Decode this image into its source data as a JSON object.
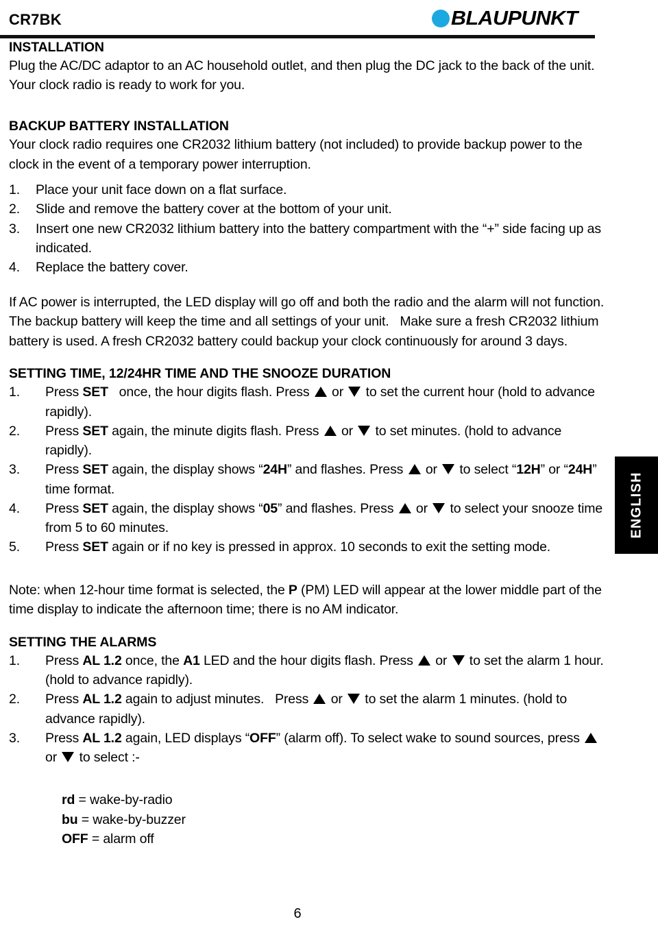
{
  "header": {
    "model_code": "CR7BK",
    "brand": "BLAUPUNKT",
    "brand_dot_color": "#1CA9E0"
  },
  "language_tab": {
    "label": "ENGLISH"
  },
  "page_number": "6",
  "sections": {
    "installation": {
      "title": "INSTALLATION",
      "body": "Plug the AC/DC adaptor to an AC household outlet, and then plug the DC jack to the back of the unit. Your clock radio is ready to work for you."
    },
    "backup_battery": {
      "title": "BACKUP BATTERY INSTALLATION",
      "intro": "Your clock radio requires one CR2032 lithium battery (not included) to provide backup power to the clock in the event of a temporary power interruption.",
      "steps": [
        {
          "num": "1.",
          "text": "Place your unit face down on a flat surface."
        },
        {
          "num": "2.",
          "text": "Slide and remove the battery cover at the bottom of your unit."
        },
        {
          "num": "3.",
          "text": "Insert one new CR2032 lithium battery into the battery compartment with the “+” side facing up as indicated."
        },
        {
          "num": "4.",
          "text": "Replace the battery cover."
        }
      ],
      "outro": "If AC power is interrupted, the LED display will go off and both the radio and the alarm will not function. The backup battery will keep the time and all settings of your unit.   Make sure a fresh CR2032 lithium battery is used. A fresh CR2032 battery could backup your clock continuously for around 3 days."
    },
    "setting_time": {
      "title": "SETTING TIME, 12/24HR TIME AND THE SNOOZE DURATION",
      "steps": [
        {
          "num": "1.",
          "parts": [
            {
              "t": "Press "
            },
            {
              "t": "SET",
              "b": true
            },
            {
              "t": "   once, the hour digits flash. Press "
            },
            {
              "icon": "triangle-up-icon"
            },
            {
              "t": " or "
            },
            {
              "icon": "triangle-down-icon"
            },
            {
              "t": " to set the current hour (hold to advance rapidly)."
            }
          ]
        },
        {
          "num": "2.",
          "parts": [
            {
              "t": "Press "
            },
            {
              "t": "SET",
              "b": true
            },
            {
              "t": " again, the minute digits flash. Press "
            },
            {
              "icon": "triangle-up-icon"
            },
            {
              "t": " or "
            },
            {
              "icon": "triangle-down-icon"
            },
            {
              "t": " to set minutes. (hold to advance rapidly)."
            }
          ]
        },
        {
          "num": "3.",
          "parts": [
            {
              "t": "Press "
            },
            {
              "t": "SET",
              "b": true
            },
            {
              "t": " again, the display shows “"
            },
            {
              "t": "24H",
              "b": true
            },
            {
              "t": "” and flashes. Press "
            },
            {
              "icon": "triangle-up-icon"
            },
            {
              "t": " or "
            },
            {
              "icon": "triangle-down-icon"
            },
            {
              "t": " to select “"
            },
            {
              "t": "12H",
              "b": true
            },
            {
              "t": "” or “"
            },
            {
              "t": "24H",
              "b": true
            },
            {
              "t": "” time format."
            }
          ]
        },
        {
          "num": "4.",
          "parts": [
            {
              "t": "Press "
            },
            {
              "t": "SET",
              "b": true
            },
            {
              "t": " again, the display shows “"
            },
            {
              "t": "05",
              "b": true
            },
            {
              "t": "” and flashes. Press "
            },
            {
              "icon": "triangle-up-icon"
            },
            {
              "t": " or "
            },
            {
              "icon": "triangle-down-icon"
            },
            {
              "t": " to select your snooze time from 5 to 60 minutes."
            }
          ]
        },
        {
          "num": "5.",
          "parts": [
            {
              "t": "Press "
            },
            {
              "t": "SET",
              "b": true
            },
            {
              "t": " again or if no key is pressed in approx. 10 seconds to exit the setting mode."
            }
          ]
        }
      ]
    },
    "note": {
      "parts": [
        {
          "t": "Note: when 12-hour time format is selected, the "
        },
        {
          "t": "P",
          "b": true
        },
        {
          "t": " (PM) LED will appear at the lower middle part of the time display to indicate the afternoon time; there is no AM indicator."
        }
      ]
    },
    "setting_alarms": {
      "title": "SETTING THE ALARMS",
      "steps": [
        {
          "num": "1.",
          "parts": [
            {
              "t": "Press "
            },
            {
              "t": "AL 1.2",
              "b": true
            },
            {
              "t": " once, the "
            },
            {
              "t": "A1",
              "b": true
            },
            {
              "t": " LED and the hour digits flash. Press "
            },
            {
              "icon": "triangle-up-icon"
            },
            {
              "t": " or "
            },
            {
              "icon": "triangle-down-icon"
            },
            {
              "t": " to set the alarm 1 hour. (hold to advance rapidly)."
            }
          ]
        },
        {
          "num": "2.",
          "parts": [
            {
              "t": "Press "
            },
            {
              "t": "AL 1.2",
              "b": true
            },
            {
              "t": " again to adjust minutes.   Press "
            },
            {
              "icon": "triangle-up-icon"
            },
            {
              "t": " or "
            },
            {
              "icon": "triangle-down-icon"
            },
            {
              "t": " to set the alarm 1 minutes. (hold to advance rapidly)."
            }
          ]
        },
        {
          "num": "3.",
          "parts": [
            {
              "t": "Press "
            },
            {
              "t": "AL 1.2",
              "b": true
            },
            {
              "t": " again, LED displays “"
            },
            {
              "t": "OFF",
              "b": true
            },
            {
              "t": "” (alarm off). To select wake to sound sources, press "
            },
            {
              "icon": "triangle-up-icon"
            },
            {
              "t": " or "
            },
            {
              "icon": "triangle-down-icon"
            },
            {
              "t": " to select :-"
            }
          ]
        }
      ]
    },
    "legend": [
      {
        "key": "rd",
        "value": " = wake-by-radio"
      },
      {
        "key": "bu",
        "value": " = wake-by-buzzer"
      },
      {
        "key": "OFF",
        "value": " = alarm off"
      }
    ]
  }
}
